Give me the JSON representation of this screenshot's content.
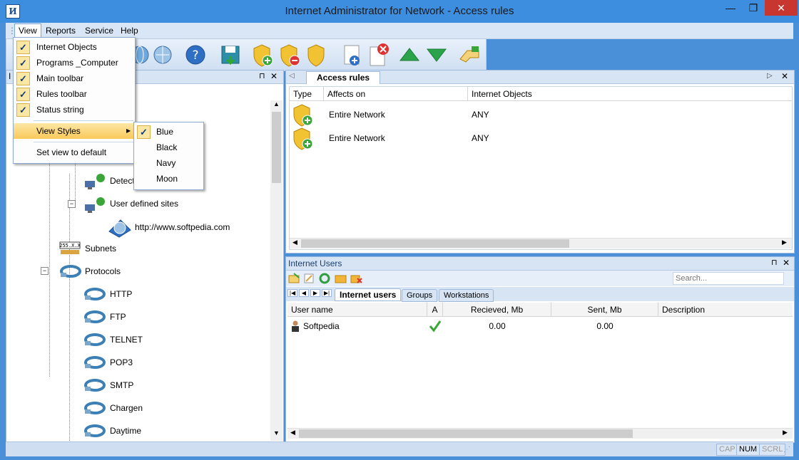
{
  "window": {
    "title": "Internet Administrator for Network - Access rules",
    "app_icon_glyph": "И",
    "minimize_glyph": "—",
    "maximize_glyph": "❐",
    "close_glyph": "✕"
  },
  "menubar": {
    "items": [
      {
        "label": "View"
      },
      {
        "label": "Reports"
      },
      {
        "label": "Service"
      },
      {
        "label": "Help"
      }
    ]
  },
  "view_menu": {
    "items": [
      {
        "label": "Internet Objects",
        "checked": true
      },
      {
        "label": "Programs _Computer",
        "checked": true
      },
      {
        "label": "Main toolbar",
        "checked": true
      },
      {
        "label": "Rules toolbar",
        "checked": true
      },
      {
        "label": "Status string",
        "checked": true
      }
    ],
    "view_styles_label": "View Styles",
    "set_default_label": "Set view to default",
    "check_glyph": "✓",
    "submenu_arrow": "▶"
  },
  "styles_submenu": {
    "items": [
      {
        "label": "Blue",
        "checked": true
      },
      {
        "label": "Black",
        "checked": false
      },
      {
        "label": "Navy",
        "checked": false
      },
      {
        "label": "Moon",
        "checked": false
      }
    ]
  },
  "left_panel": {
    "title_fragment": "I",
    "pin_glyph": "⊓",
    "close_glyph": "✕",
    "tree": [
      {
        "label": "Detect",
        "icon": "network-computer-icon"
      },
      {
        "label": "User defined sites",
        "icon": "network-computer-icon"
      },
      {
        "label": "http://www.softpedia.com",
        "icon": "globe-icon"
      },
      {
        "label": "Subnets",
        "icon": "subnet-icon"
      },
      {
        "label": "Protocols",
        "icon": "cable-icon"
      },
      {
        "label": "HTTP",
        "icon": "cable-icon"
      },
      {
        "label": "FTP",
        "icon": "cable-icon"
      },
      {
        "label": "TELNET",
        "icon": "cable-icon"
      },
      {
        "label": "POP3",
        "icon": "cable-icon"
      },
      {
        "label": "SMTP",
        "icon": "cable-icon"
      },
      {
        "label": "Chargen",
        "icon": "cable-icon"
      },
      {
        "label": "Daytime",
        "icon": "cable-icon"
      }
    ],
    "subnet_badge": "255.X.X"
  },
  "rules_panel": {
    "tab_label": "Access rules",
    "columns": [
      "Type",
      "Affects on",
      "Internet Objects"
    ],
    "rows": [
      {
        "affects_on": "Entire Network",
        "internet_objects": "ANY"
      },
      {
        "affects_on": "Entire Network",
        "internet_objects": "ANY"
      }
    ]
  },
  "users_panel": {
    "title": "Internet Users",
    "search_placeholder": "Search...",
    "tabs": [
      "Internet users",
      "Groups",
      "Workstations"
    ],
    "columns": [
      "User name",
      "A",
      "Recieved, Mb",
      "Sent, Mb",
      "Description"
    ],
    "rows": [
      {
        "user_name": "Softpedia",
        "active": true,
        "received": "0.00",
        "sent": "0.00",
        "description": ""
      }
    ]
  },
  "statusbar": {
    "indicators": [
      "CAP",
      "NUM",
      "SCRL"
    ]
  },
  "colors": {
    "window_frame": "#3e8ee0",
    "menu_highlight": "#f9c95a",
    "close_button": "#c7372f",
    "shield_gold": "#f1c232",
    "add_green": "#3aa63a"
  }
}
